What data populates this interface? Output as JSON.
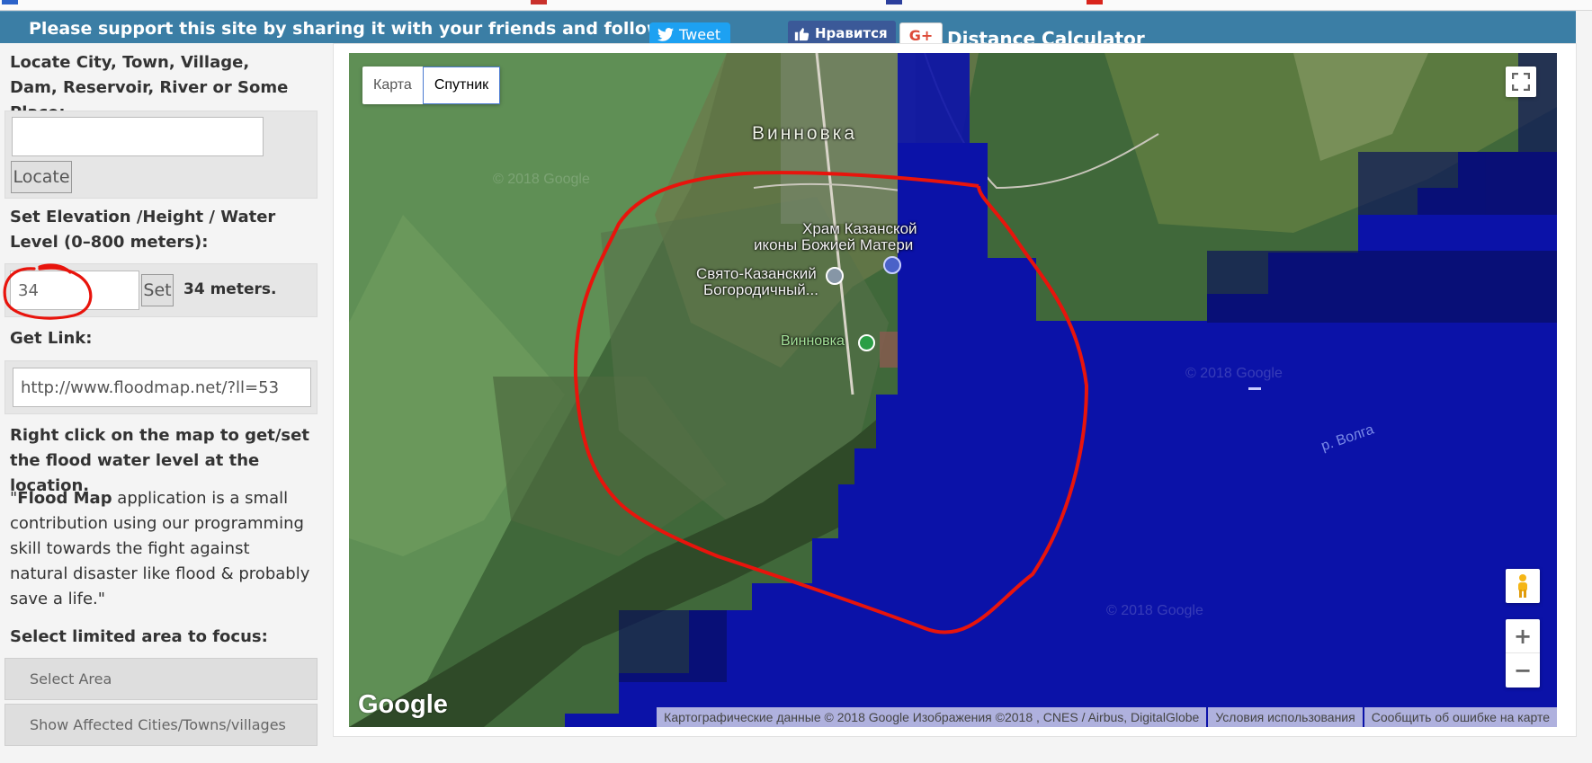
{
  "share_bar": {
    "message": "Please support this site by sharing it with your friends and followers",
    "tweet_label": "Tweet",
    "like_label": "Нравится",
    "gplus_label": "G+",
    "distance_link": "Distance Calculator"
  },
  "sidebar": {
    "locate_label": "Locate City, Town, Village, Dam, Reservoir, River or Some Place:",
    "locate_input_value": "",
    "locate_button": "Locate",
    "elevation_label": "Set Elevation /Height / Water Level (0–800 meters):",
    "elevation_value": "34",
    "set_button": "Set",
    "elevation_readout": "34 meters.",
    "get_link_label": "Get Link:",
    "link_value": "http://www.floodmap.net/?ll=53",
    "right_click_hint": "Right click on the map to get/set the flood water level at the location.",
    "about_quote_open": "\"",
    "about_app_name": "Flood Map",
    "about_text": " application is a small contribution using our programming skill towards the fight against natural disaster like flood & probably save a life.\"",
    "focus_label": "Select limited area to focus:",
    "select_area_button": "Select Area",
    "show_affected_button": "Show Affected Cities/Towns/villages"
  },
  "map": {
    "type_map": "Карта",
    "type_satellite": "Спутник",
    "active_type": "Спутник",
    "labels": {
      "village_big": "Винновка",
      "church_line1": "Храм Казанской",
      "church_line2": "иконы Божией Матери",
      "monastery_line1": "Свято-Казанский",
      "monastery_line2": "Богородичный...",
      "pier": "Винновка",
      "river": "р. Волга",
      "watermark": "© 2018 Google"
    },
    "google_logo": "Google",
    "attribution": "Картографические данные © 2018 Google Изображения ©2018 , CNES / Airbus, DigitalGlobe",
    "terms": "Условия использования",
    "report": "Сообщить об ошибке на карте",
    "zoom_in": "+",
    "zoom_out": "−",
    "colors": {
      "flood": "#0b12a8",
      "annotation": "#e8140c"
    }
  }
}
